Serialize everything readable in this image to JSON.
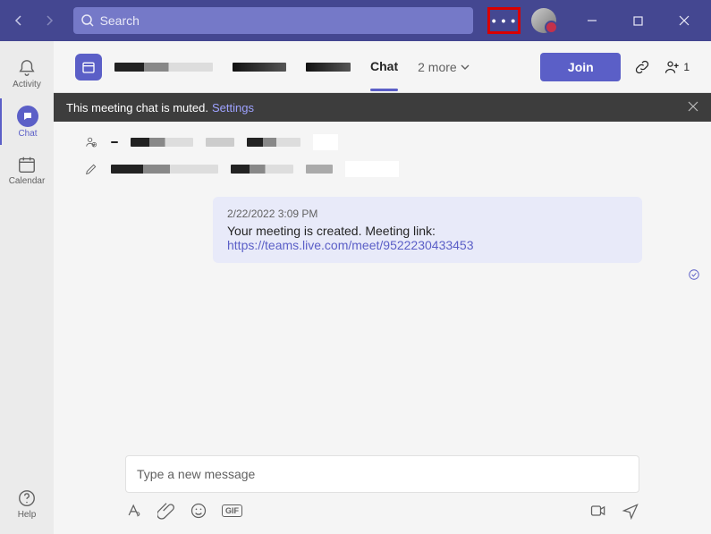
{
  "titlebar": {
    "search_placeholder": "Search",
    "ellipsis": "• • •"
  },
  "rail": {
    "activity": "Activity",
    "chat": "Chat",
    "calendar": "Calendar",
    "help": "Help"
  },
  "header": {
    "tab_chat": "Chat",
    "more": "2 more",
    "join": "Join",
    "participant_count": "1"
  },
  "banner": {
    "text": "This meeting chat is muted.",
    "link": "Settings"
  },
  "message": {
    "timestamp": "2/22/2022 3:09 PM",
    "body": "Your meeting is created. Meeting link:",
    "link": "https://teams.live.com/meet/9522230433453"
  },
  "composer": {
    "placeholder": "Type a new message",
    "gif_label": "GIF"
  }
}
